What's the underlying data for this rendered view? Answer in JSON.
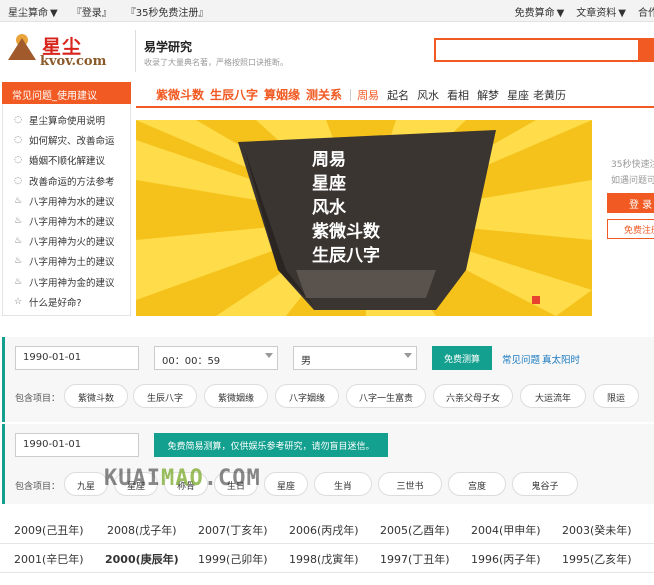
{
  "topbar": {
    "left": [
      "星尘算命",
      "『登录』",
      "『35秒免费注册』"
    ],
    "right": [
      "免费算命",
      "文章资料",
      "合作"
    ]
  },
  "header": {
    "logo_cn": "星尘",
    "logo_en": "kvov.com",
    "site_name": "易学研究",
    "site_desc": "收录了大量典名著，严格按照口诀推断。",
    "search_value": ""
  },
  "nav": {
    "left_title": "常见问题_使用建议",
    "bold_items": [
      "紫微斗数",
      "生辰八字",
      "算姻缘",
      "测关系"
    ],
    "items": [
      "周易",
      "起名",
      "风水",
      "看相",
      "解梦",
      "星座",
      "老黄历"
    ]
  },
  "sidebar": {
    "items": [
      {
        "label": "星尘算命使用说明",
        "icon": "chat-bubble-icon"
      },
      {
        "label": "如何解灾、改善命运",
        "icon": "chat-bubble-icon"
      },
      {
        "label": "婚姻不顺化解建议",
        "icon": "chat-bubble-icon"
      },
      {
        "label": "改善命运的方法参考",
        "icon": "chat-bubble-icon"
      },
      {
        "label": "八字用神为水的建议",
        "icon": "flame-icon"
      },
      {
        "label": "八字用神为木的建议",
        "icon": "flame-icon"
      },
      {
        "label": "八字用神为火的建议",
        "icon": "flame-icon"
      },
      {
        "label": "八字用神为土的建议",
        "icon": "flame-icon"
      },
      {
        "label": "八字用神为金的建议",
        "icon": "flame-icon"
      },
      {
        "label": "什么是好命?",
        "icon": "star-icon"
      }
    ]
  },
  "banner": {
    "lines": [
      "周易",
      "星座",
      "风水",
      "紫微斗数",
      "生辰八字"
    ]
  },
  "login": {
    "text1": "35秒快速注",
    "text2": "如遇问题可",
    "login_label": "登 录",
    "register_label": "免费注册"
  },
  "form1": {
    "date_value": "1990-01-01",
    "time_value": "00：00：59",
    "gender_value": "男",
    "submit_label": "免费测算",
    "link1": "常见问题",
    "link2": "真太阳时",
    "include_label": "包含项目：",
    "pills": [
      "紫微斗数",
      "生辰八字",
      "紫微姻缘",
      "八字姻缘",
      "八字一生富贵",
      "六亲父母子女",
      "大运流年",
      "限运"
    ]
  },
  "form2": {
    "date_value": "1990-01-01",
    "submit_label": "免费简易测算，仅供娱乐参考研究，请勿盲目迷信。",
    "include_label": "包含项目：",
    "pills": [
      "九星",
      "星座",
      "称骨",
      "生日",
      "星座",
      "生肖",
      "三世书",
      "宫度",
      "鬼谷子"
    ]
  },
  "watermark": {
    "part1": "KUAI",
    "part2": "MAO",
    "part3": ".COM"
  },
  "years": {
    "row1": [
      "2009(己丑年)",
      "2008(戊子年)",
      "2007(丁亥年)",
      "2006(丙戌年)",
      "2005(乙酉年)",
      "2004(甲申年)",
      "2003(癸未年)"
    ],
    "row2": [
      "2001(辛巳年)",
      "2000(庚辰年)",
      "1999(己卯年)",
      "1998(戊寅年)",
      "1997(丁丑年)",
      "1996(丙子年)",
      "1995(乙亥年)"
    ]
  },
  "colors": {
    "accent": "#f15a22",
    "teal": "#13a08f",
    "banner_yellow": "#f4c21b"
  }
}
